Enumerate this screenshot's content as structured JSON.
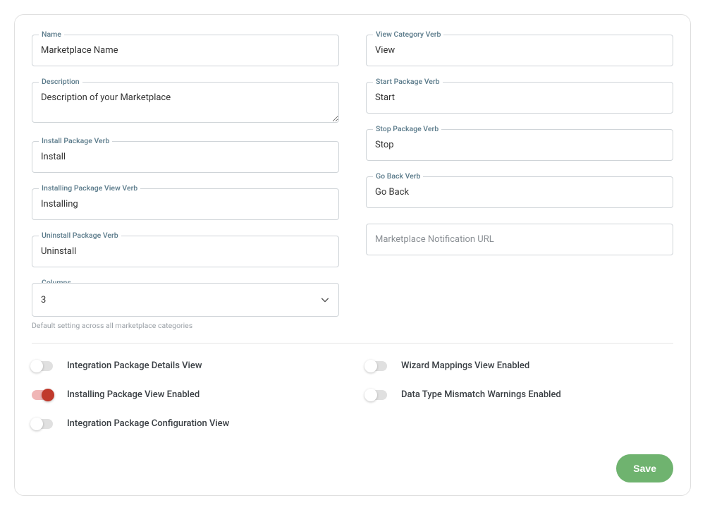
{
  "left": {
    "name": {
      "label": "Name",
      "value": "Marketplace Name"
    },
    "description": {
      "label": "Description",
      "value": "Description of your Marketplace"
    },
    "install": {
      "label": "Install Package Verb",
      "value": "Install"
    },
    "installing": {
      "label": "Installing Package View Verb",
      "value": "Installing"
    },
    "uninstall": {
      "label": "Uninstall Package Verb",
      "value": "Uninstall"
    },
    "columns": {
      "label": "Columns",
      "value": "3",
      "helper": "Default setting across all marketplace categories"
    }
  },
  "right": {
    "viewCat": {
      "label": "View Category Verb",
      "value": "View"
    },
    "startPkg": {
      "label": "Start Package Verb",
      "value": "Start"
    },
    "stopPkg": {
      "label": "Stop Package Verb",
      "value": "Stop"
    },
    "goBack": {
      "label": "Go Back Verb",
      "value": "Go Back"
    },
    "notifUrl": {
      "placeholder": "Marketplace Notification URL",
      "value": ""
    }
  },
  "toggles": {
    "left": [
      {
        "label": "Integration Package Details View",
        "on": false
      },
      {
        "label": "Installing Package View Enabled",
        "on": true
      },
      {
        "label": "Integration Package Configuration View",
        "on": false
      }
    ],
    "right": [
      {
        "label": "Wizard Mappings View Enabled",
        "on": false
      },
      {
        "label": "Data Type Mismatch Warnings Enabled",
        "on": false
      }
    ]
  },
  "actions": {
    "save": "Save"
  }
}
